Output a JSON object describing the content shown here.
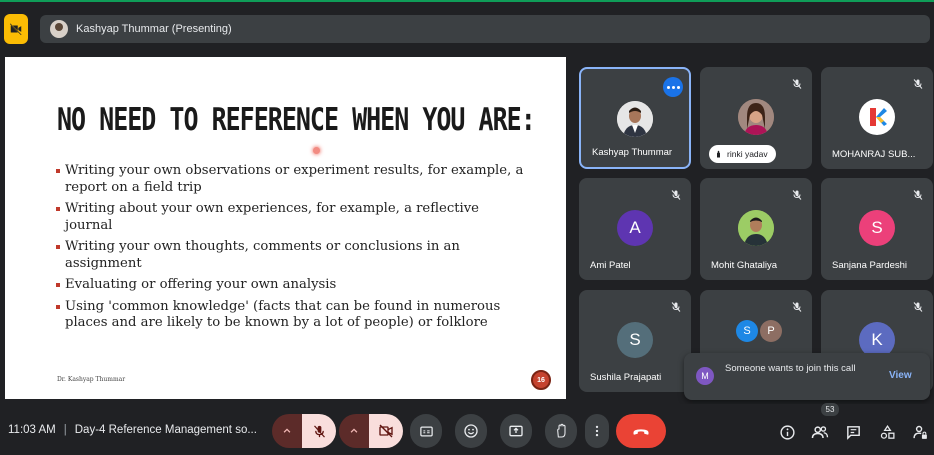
{
  "topbar": {
    "presenting_label": "Kashyap Thummar (Presenting)"
  },
  "slide": {
    "title": "NO NEED TO REFERENCE WHEN YOU ARE:",
    "bullets": [
      "Writing your own observations or experiment results, for example, a report on a field trip",
      "Writing about your own experiences, for example, a reflective journal",
      "Writing your own thoughts, comments or conclusions in an assignment",
      "Evaluating or offering your own analysis",
      "Using 'common knowledge' (facts that can be found in numerous places and are likely to be known by a lot of people) or folklore"
    ],
    "author": "Dr. Kashyap Thummar",
    "page_number": "16"
  },
  "participants": [
    {
      "name": "Kashyap Thummar",
      "avatar": "photo",
      "color": "#d9d9d9"
    },
    {
      "name": "rinki yadav",
      "avatar": "photo",
      "color": "#c98e6b"
    },
    {
      "name": "MOHANRAJ SUB...",
      "avatar": "logo",
      "color": "#ffffff"
    },
    {
      "name": "Ami Patel",
      "avatar": "A",
      "color": "#5e35b1"
    },
    {
      "name": "Mohit Ghataliya",
      "avatar": "photo",
      "color": "#7cb342"
    },
    {
      "name": "Sanjana Pardeshi",
      "avatar": "S",
      "color": "#ec407a"
    },
    {
      "name": "Sushila Prajapati",
      "avatar": "S",
      "color": "#546e7a"
    },
    {
      "name": "",
      "avatar": "S P",
      "color": "#1e88e5"
    },
    {
      "name": "",
      "avatar": "K",
      "color": "#5c6bc0"
    }
  ],
  "toast": {
    "avatar": "M",
    "message": "Someone wants to join this call",
    "action": "View"
  },
  "bottombar": {
    "time": "11:03 AM",
    "meeting_title": "Day-4 Reference Management so...",
    "people_count": "53"
  },
  "colors": {
    "end_call": "#ea4335",
    "accent": "#8ab4f8",
    "warning": "#fbbc04"
  }
}
